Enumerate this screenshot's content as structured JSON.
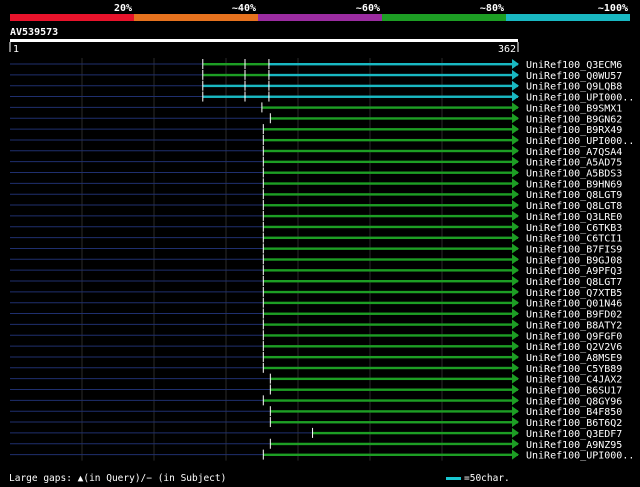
{
  "identity_legend": [
    {
      "label": "20%",
      "color": "#e8132b"
    },
    {
      "label": "~40%",
      "color": "#e6721e"
    },
    {
      "label": "~60%",
      "color": "#9b2ca1"
    },
    {
      "label": "~80%",
      "color": "#1d9e24"
    },
    {
      "label": "~100%",
      "color": "#19b8c2"
    }
  ],
  "query": {
    "name": "AV539573",
    "start_label": "1",
    "end_label": "362"
  },
  "footer": {
    "gaps_text": "Large gaps: ▲(in Query)/− (in Subject)",
    "scale_text": "=50char.",
    "scale_color": "#19c8d2"
  },
  "chart_data": {
    "type": "alignment",
    "query_length": 362,
    "xlim": [
      1,
      362
    ],
    "hits": [
      {
        "name": "UniRef100_Q3ECM6",
        "segments": [
          [
            138,
            168,
            "#1d9e24"
          ],
          [
            168,
            185,
            "#1d9e24"
          ],
          [
            185,
            362,
            "#19b8c2"
          ]
        ]
      },
      {
        "name": "UniRef100_Q0WU57",
        "segments": [
          [
            138,
            168,
            "#1d9e24"
          ],
          [
            168,
            185,
            "#1d9e24"
          ],
          [
            185,
            362,
            "#19b8c2"
          ]
        ]
      },
      {
        "name": "UniRef100_Q9LQB8",
        "segments": [
          [
            138,
            168,
            "#19b8c2"
          ],
          [
            168,
            185,
            "#19b8c2"
          ],
          [
            185,
            362,
            "#19b8c2"
          ]
        ]
      },
      {
        "name": "UniRef100_UPI000..",
        "segments": [
          [
            138,
            168,
            "#19b8c2"
          ],
          [
            168,
            185,
            "#19b8c2"
          ],
          [
            185,
            362,
            "#19b8c2"
          ]
        ]
      },
      {
        "name": "UniRef100_B9SMX1",
        "segments": [
          [
            180,
            362,
            "#1d9e24"
          ]
        ]
      },
      {
        "name": "UniRef100_B9GN62",
        "segments": [
          [
            186,
            362,
            "#1d9e24"
          ]
        ]
      },
      {
        "name": "UniRef100_B9RX49",
        "segments": [
          [
            181,
            362,
            "#1d9e24"
          ]
        ]
      },
      {
        "name": "UniRef100_UPI000..",
        "segments": [
          [
            181,
            362,
            "#1d9e24"
          ]
        ]
      },
      {
        "name": "UniRef100_A7QSA4",
        "segments": [
          [
            181,
            362,
            "#1d9e24"
          ]
        ]
      },
      {
        "name": "UniRef100_A5AD75",
        "segments": [
          [
            181,
            362,
            "#1d9e24"
          ]
        ]
      },
      {
        "name": "UniRef100_A5BDS3",
        "segments": [
          [
            181,
            362,
            "#1d9e24"
          ]
        ]
      },
      {
        "name": "UniRef100_B9HN69",
        "segments": [
          [
            181,
            362,
            "#1d9e24"
          ]
        ]
      },
      {
        "name": "UniRef100_Q8LGT9",
        "segments": [
          [
            181,
            362,
            "#1d9e24"
          ]
        ]
      },
      {
        "name": "UniRef100_Q8LGT8",
        "segments": [
          [
            181,
            362,
            "#1d9e24"
          ]
        ]
      },
      {
        "name": "UniRef100_Q3LRE0",
        "segments": [
          [
            181,
            362,
            "#1d9e24"
          ]
        ]
      },
      {
        "name": "UniRef100_C6TKB3",
        "segments": [
          [
            181,
            362,
            "#1d9e24"
          ]
        ]
      },
      {
        "name": "UniRef100_C6TCI1",
        "segments": [
          [
            181,
            362,
            "#1d9e24"
          ]
        ]
      },
      {
        "name": "UniRef100_B7FIS9",
        "segments": [
          [
            181,
            362,
            "#1d9e24"
          ]
        ]
      },
      {
        "name": "UniRef100_B9GJ08",
        "segments": [
          [
            181,
            362,
            "#1d9e24"
          ]
        ]
      },
      {
        "name": "UniRef100_A9PFQ3",
        "segments": [
          [
            181,
            362,
            "#1d9e24"
          ]
        ]
      },
      {
        "name": "UniRef100_Q8LGT7",
        "segments": [
          [
            181,
            362,
            "#1d9e24"
          ]
        ]
      },
      {
        "name": "UniRef100_Q7XTB5",
        "segments": [
          [
            181,
            362,
            "#1d9e24"
          ]
        ]
      },
      {
        "name": "UniRef100_Q01N46",
        "segments": [
          [
            181,
            362,
            "#1d9e24"
          ]
        ]
      },
      {
        "name": "UniRef100_B9FD02",
        "segments": [
          [
            181,
            362,
            "#1d9e24"
          ]
        ]
      },
      {
        "name": "UniRef100_B8ATY2",
        "segments": [
          [
            181,
            362,
            "#1d9e24"
          ]
        ]
      },
      {
        "name": "UniRef100_Q9FGF0",
        "segments": [
          [
            181,
            362,
            "#1d9e24"
          ]
        ]
      },
      {
        "name": "UniRef100_Q2V2V6",
        "segments": [
          [
            181,
            362,
            "#1d9e24"
          ]
        ]
      },
      {
        "name": "UniRef100_A8MSE9",
        "segments": [
          [
            181,
            362,
            "#1d9e24"
          ]
        ]
      },
      {
        "name": "UniRef100_C5YB89",
        "segments": [
          [
            181,
            362,
            "#1d9e24"
          ]
        ]
      },
      {
        "name": "UniRef100_C4JAX2",
        "segments": [
          [
            186,
            362,
            "#1d9e24"
          ]
        ]
      },
      {
        "name": "UniRef100_B6SU17",
        "segments": [
          [
            186,
            362,
            "#1d9e24"
          ]
        ]
      },
      {
        "name": "UniRef100_Q8GY96",
        "segments": [
          [
            181,
            362,
            "#1d9e24"
          ]
        ]
      },
      {
        "name": "UniRef100_B4F850",
        "segments": [
          [
            186,
            362,
            "#1d9e24"
          ]
        ]
      },
      {
        "name": "UniRef100_B6T6Q2",
        "segments": [
          [
            186,
            362,
            "#1d9e24"
          ]
        ]
      },
      {
        "name": "UniRef100_Q3EDF7",
        "segments": [
          [
            216,
            362,
            "#1d9e24"
          ]
        ]
      },
      {
        "name": "UniRef100_A9NZ95",
        "segments": [
          [
            186,
            362,
            "#1d9e24"
          ]
        ]
      },
      {
        "name": "UniRef100_UPI000..",
        "segments": [
          [
            181,
            362,
            "#1d9e24"
          ]
        ]
      }
    ]
  }
}
